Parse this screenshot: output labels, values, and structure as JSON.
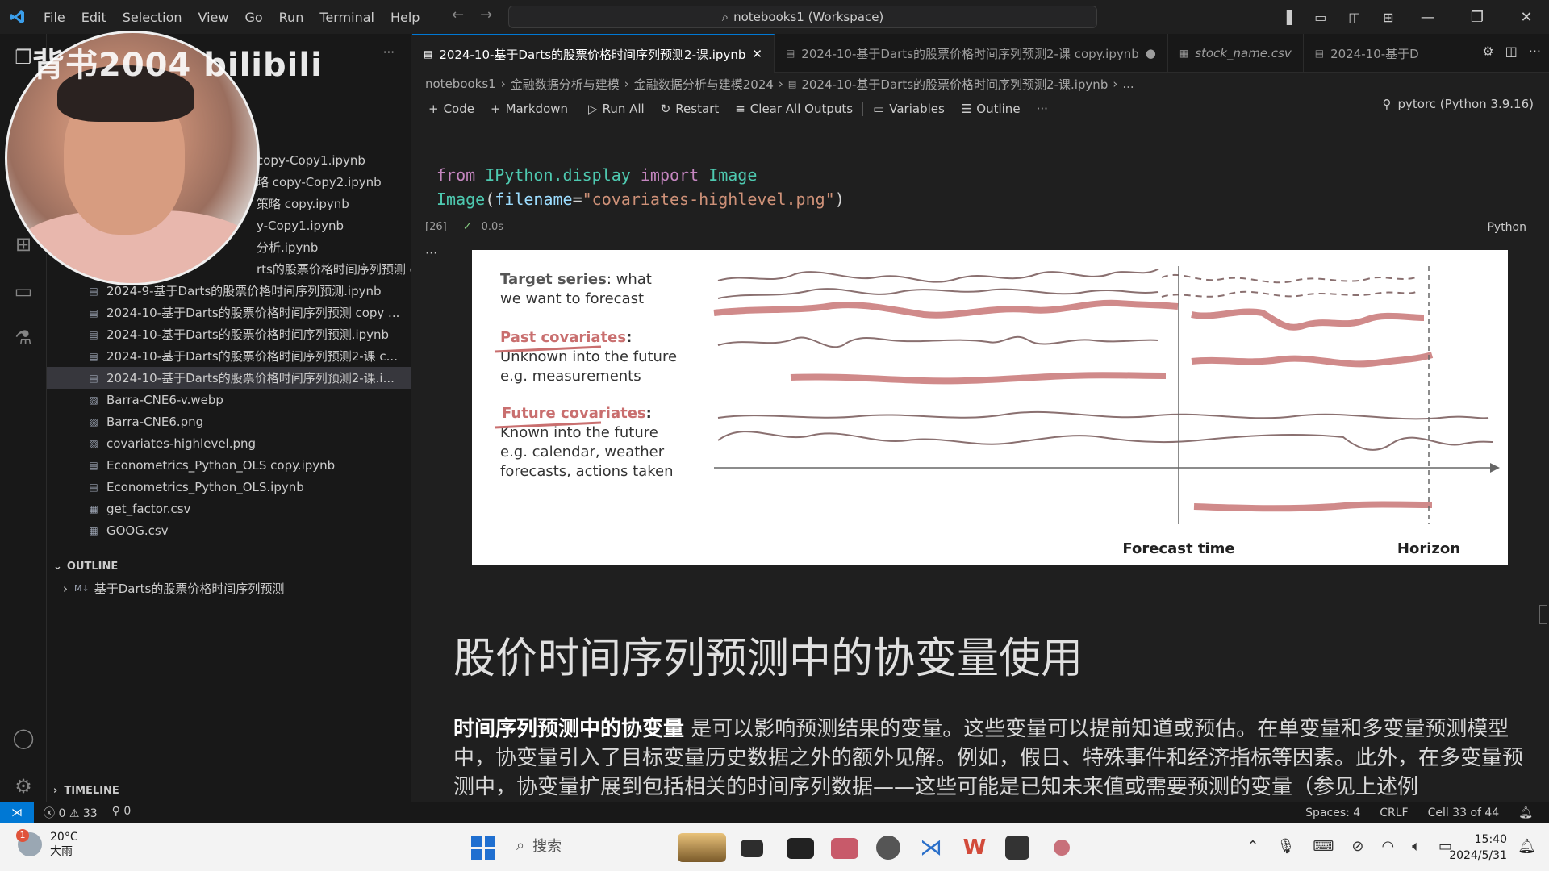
{
  "menu": [
    "File",
    "Edit",
    "Selection",
    "View",
    "Go",
    "Run",
    "Terminal",
    "Help"
  ],
  "search": {
    "label": "notebooks1 (Workspace)"
  },
  "sidebar": {
    "files": [
      "copy-Copy1.ipynb",
      "略 copy-Copy2.ipynb",
      "策略 copy.ipynb",
      "y-Copy1.ipynb",
      "分析.ipynb",
      "rts的股票价格时间序列预测 copy.ip...",
      "2024-9-基于Darts的股票价格时间序列预测.ipynb",
      "2024-10-基于Darts的股票价格时间序列预测 copy ...",
      "2024-10-基于Darts的股票价格时间序列预测.ipynb",
      "2024-10-基于Darts的股票价格时间序列预测2-课 c...",
      "2024-10-基于Darts的股票价格时间序列预测2-课.i...",
      "Barra-CNE6-v.webp",
      "Barra-CNE6.png",
      "covariates-highlevel.png",
      "Econometrics_Python_OLS copy.ipynb",
      "Econometrics_Python_OLS.ipynb",
      "get_factor.csv",
      "GOOG.csv"
    ],
    "outline_header": "OUTLINE",
    "outline_item": "基于Darts的股票价格时间序列预测",
    "timeline_header": "TIMELINE"
  },
  "watermark": "背书2004 bilibili",
  "tabs": [
    "2024-10-基于Darts的股票价格时间序列预测2-课.ipynb",
    "2024-10-基于Darts的股票价格时间序列预测2-课 copy.ipynb",
    "stock_name.csv",
    "2024-10-基于D"
  ],
  "breadcrumb": [
    "notebooks1",
    "金融数据分析与建模",
    "金融数据分析与建模2024",
    "2024-10-基于Darts的股票价格时间序列预测2-课.ipynb",
    "..."
  ],
  "toolbar": {
    "code": "Code",
    "markdown": "Markdown",
    "run_all": "Run All",
    "restart": "Restart",
    "clear": "Clear All Outputs",
    "variables": "Variables",
    "outline": "Outline",
    "kernel": "pytorc (Python 3.9.16)"
  },
  "cell": {
    "exec_count": "[26]",
    "time": "0.0s",
    "lang": "Python",
    "line1": {
      "from": "from",
      "module": "IPython.display",
      "import": "import",
      "name": "Image"
    },
    "line2": {
      "fn": "Image",
      "param": "filename",
      "str": "\"covariates-highlevel.png\""
    }
  },
  "diagram": {
    "target_title": "Target series",
    "target_rest": ": what",
    "target_line2": "we want to forecast",
    "past_title": "Past covariates",
    "past_colon": ":",
    "past_line2": "Unknown into the future",
    "past_line3": "e.g. measurements",
    "future_title": "Future covariates",
    "future_colon": ":",
    "future_line2": "Known into the future",
    "future_line3": "e.g. calendar, weather",
    "future_line4": "forecasts, actions taken",
    "forecast_time": "Forecast time",
    "horizon": "Horizon"
  },
  "markdown": {
    "heading": "股价时间序列预测中的协变量使用",
    "bold": "时间序列预测中的协变量",
    "para": " 是可以影响预测结果的变量。这些变量可以提前知道或预估。在单变量和多变量预测模型中，协变量引入了目标变量历史数据之外的额外见解。例如，假日、特殊事件和经济指标等因素。此外，在多变量预测中，协变量扩展到包括相关的时间序列数据——这些可能是已知未来值或需要预测的变量（参见上述例"
  },
  "status": {
    "errors": "0",
    "warnings": "33",
    "ports": "0",
    "spaces": "Spaces: 4",
    "eol": "CRLF",
    "cell": "Cell 33 of 44"
  },
  "taskbar": {
    "temp": "20°C",
    "weather": "大雨",
    "badge": "1",
    "search": "搜索",
    "time": "15:40",
    "date": "2024/5/31"
  }
}
